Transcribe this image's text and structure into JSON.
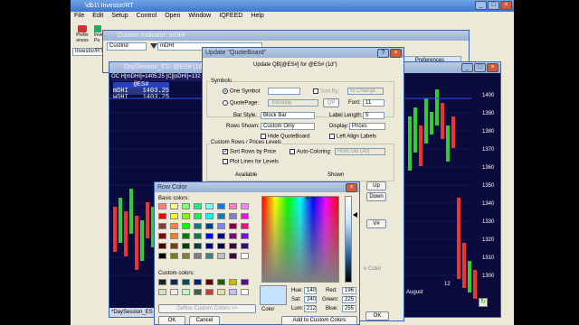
{
  "investor_window": {
    "title": "\\db1\\ Investor/RT",
    "menu": [
      "File",
      "Edit",
      "Setup",
      "Control",
      "Open",
      "Window",
      "IQFEED",
      "Help"
    ],
    "toolbar_labels": [
      "Prefer ences",
      "Investor Pa"
    ],
    "toolbar_combo": "Investor/RT"
  },
  "custom_indicator": {
    "title": "Custom Indicator: mDHI",
    "type_value": "CustInd",
    "name_value": "mDHI"
  },
  "chart_window": {
    "title": "DaySession_ES: @ES# [1d\" 1 Day\"...",
    "header_text": "OC H[mDHI]=1405.25 [C][oDHI]=132",
    "quote_title": "@ES#",
    "quote_rows": [
      {
        "name": "mDHI",
        "value": "1403.25"
      },
      {
        "name": "wDHI",
        "value": "1403.25"
      }
    ],
    "price_ticks": [
      "1400",
      "1390",
      "1380",
      "1370",
      "1360",
      "1350",
      "1340",
      "1330",
      "1320",
      "1310",
      "1300"
    ],
    "date_label": "August",
    "day_label": "12",
    "tab_label": "*DaySession_ES"
  },
  "preferences_tab": "Preferences",
  "quoteboard": {
    "title": "Update \"QuoteBoard\"",
    "header": "Update QB[@ES#] for @ES# (1d\")",
    "symbols_label": "Symbols",
    "one_symbol": "One Symbol:",
    "quotepage": "QuotePage:",
    "quotepage_value": ".Intraday",
    "sort_by": "Sort By:",
    "sort_value": "% Change",
    "qp": "QP",
    "font_label": "Font:",
    "font_value": "11",
    "bar_style_label": "Bar Style:",
    "bar_style_value": "Block Bar",
    "label_length_label": "Label Length:",
    "label_length_value": "5",
    "rows_shown_label": "Rows Shown:",
    "rows_shown_value": "Custom Only",
    "display_label": "Display:",
    "display_value": "Prices",
    "hide_quoteboard": "Hide QuoteBoard",
    "left_align": "Left Align Labels",
    "custom_rows_group": "Custom Rows / Prices Levels",
    "sort_rows": "Sort Rows by Price",
    "auto_coloring": "Auto-Coloring:",
    "auto_coloring_value": "Hot/Cold (All)",
    "plot_lines": "Plot Lines for Levels",
    "available": "Available",
    "shown": "Shown",
    "up": "Up",
    "down": "Down",
    "v_hash": "V#",
    "ok": "OK",
    "color_hint": "e Color"
  },
  "row_color": {
    "title": "Row Color",
    "basic_colors": "Basic colors:",
    "custom_colors": "Custom colors:",
    "define_custom": "Define Custom Colors >>",
    "ok": "OK",
    "cancel": "Cancel",
    "color_solid": "Color",
    "hue_label": "Hue:",
    "hue": "140",
    "sat_label": "Sat:",
    "sat": "240",
    "lum_label": "Lum:",
    "lum": "212",
    "red_label": "Red:",
    "red": "196",
    "green_label": "Green:",
    "green": "225",
    "blue_label": "Blue:",
    "blue": "255",
    "add_custom": "Add to Custom Colors",
    "basic_palette": [
      "#ff8080",
      "#ffff80",
      "#80ff80",
      "#00ff80",
      "#80ffff",
      "#0080ff",
      "#ff80c0",
      "#ff80ff",
      "#ff0000",
      "#ffff00",
      "#80ff00",
      "#00ff40",
      "#00ffff",
      "#0080c0",
      "#8080c0",
      "#ff00ff",
      "#804040",
      "#ff8040",
      "#00ff00",
      "#008080",
      "#004080",
      "#8080ff",
      "#800040",
      "#ff0080",
      "#800000",
      "#ff8000",
      "#008000",
      "#008040",
      "#0000ff",
      "#0000a0",
      "#800080",
      "#8000ff",
      "#400000",
      "#804000",
      "#004000",
      "#004040",
      "#000080",
      "#000040",
      "#400040",
      "#400080",
      "#000000",
      "#808000",
      "#808040",
      "#808080",
      "#408080",
      "#c0c0c0",
      "#400040",
      "#ffffff"
    ],
    "custom_palette": [
      "#202020",
      "#003060",
      "#005050",
      "#002080",
      "#600000",
      "#206000",
      "#c0c000",
      "#6000a0",
      "#d0e0c0",
      "#f0f0f0",
      "#c0ffc0",
      "#406040",
      "#c04040",
      "#e0e0a0",
      "#c0c0ff",
      "#ffffff"
    ],
    "selected_color": "#c4e1ff"
  }
}
